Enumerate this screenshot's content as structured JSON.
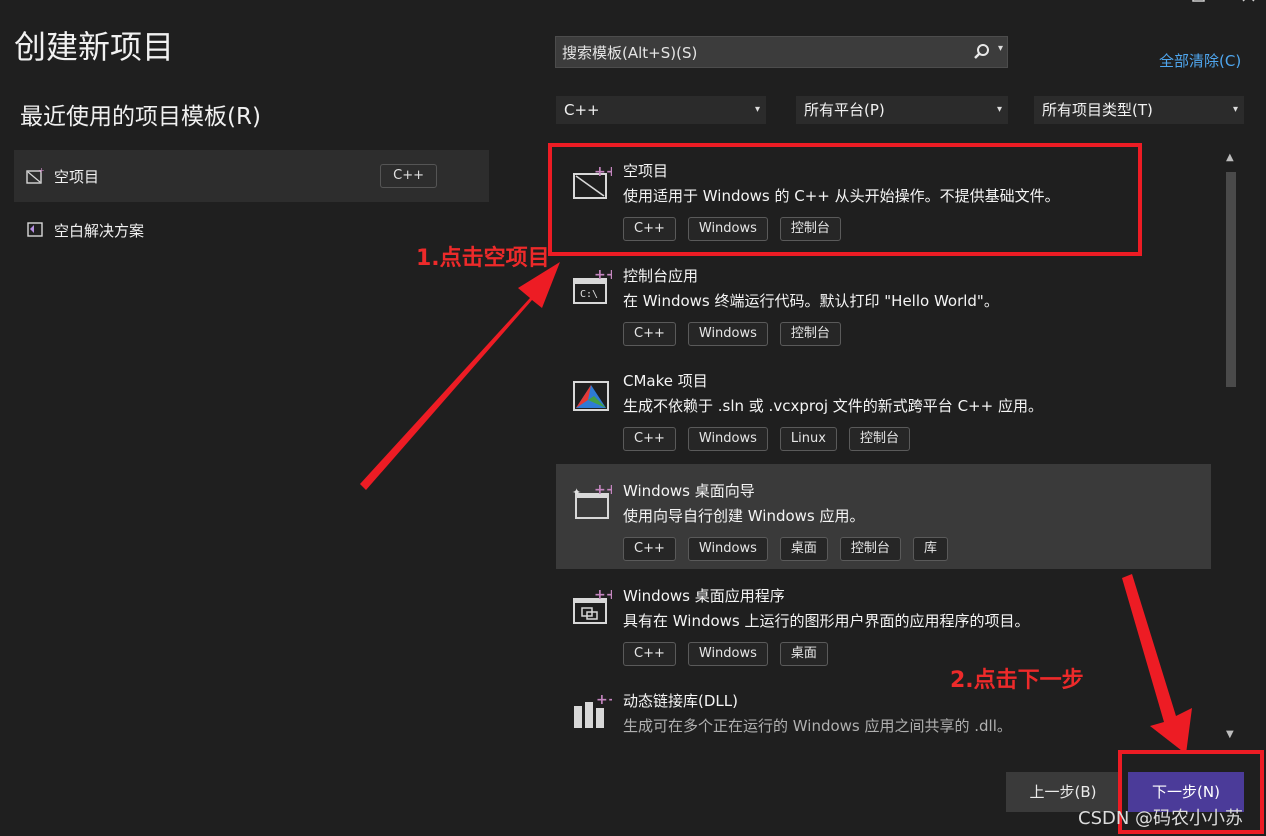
{
  "header": {
    "title": "创建新项目",
    "search_placeholder": "搜索模板(Alt+S)(S)",
    "clear_all": "全部清除(C)"
  },
  "recent": {
    "title": "最近使用的项目模板(R)",
    "items": [
      {
        "label": "空项目",
        "tag": "C++"
      },
      {
        "label": "空白解决方案"
      }
    ]
  },
  "filters": {
    "language": "C++",
    "platform": "所有平台(P)",
    "project_type": "所有项目类型(T)"
  },
  "templates": [
    {
      "name": "空项目",
      "desc": "使用适用于 Windows 的 C++ 从头开始操作。不提供基础文件。",
      "tags": [
        "C++",
        "Windows",
        "控制台"
      ],
      "icon": "empty-project-icon"
    },
    {
      "name": "控制台应用",
      "desc": "在 Windows 终端运行代码。默认打印 \"Hello World\"。",
      "tags": [
        "C++",
        "Windows",
        "控制台"
      ],
      "icon": "console-app-icon"
    },
    {
      "name": "CMake 项目",
      "desc": "生成不依赖于 .sln 或 .vcxproj 文件的新式跨平台 C++ 应用。",
      "tags": [
        "C++",
        "Windows",
        "Linux",
        "控制台"
      ],
      "icon": "cmake-icon"
    },
    {
      "name": "Windows 桌面向导",
      "desc": "使用向导自行创建 Windows 应用。",
      "tags": [
        "C++",
        "Windows",
        "桌面",
        "控制台",
        "库"
      ],
      "icon": "desktop-wizard-icon"
    },
    {
      "name": "Windows 桌面应用程序",
      "desc": "具有在 Windows 上运行的图形用户界面的应用程序的项目。",
      "tags": [
        "C++",
        "Windows",
        "桌面"
      ],
      "icon": "desktop-app-icon"
    },
    {
      "name": "动态链接库(DLL)",
      "desc": "生成可在多个正在运行的 Windows 应用之间共享的 .dll。",
      "tags": [],
      "icon": "dll-icon"
    }
  ],
  "footer": {
    "back": "上一步(B)",
    "next": "下一步(N)"
  },
  "annotations": {
    "step1": "1.点击空项目",
    "step2": "2.点击下一步",
    "accent": "#ed1c24"
  },
  "watermark": "CSDN @码农小小苏",
  "colors": {
    "background": "#1f1f1f",
    "primary_button": "#4b3b99",
    "link": "#4fa6ee"
  }
}
